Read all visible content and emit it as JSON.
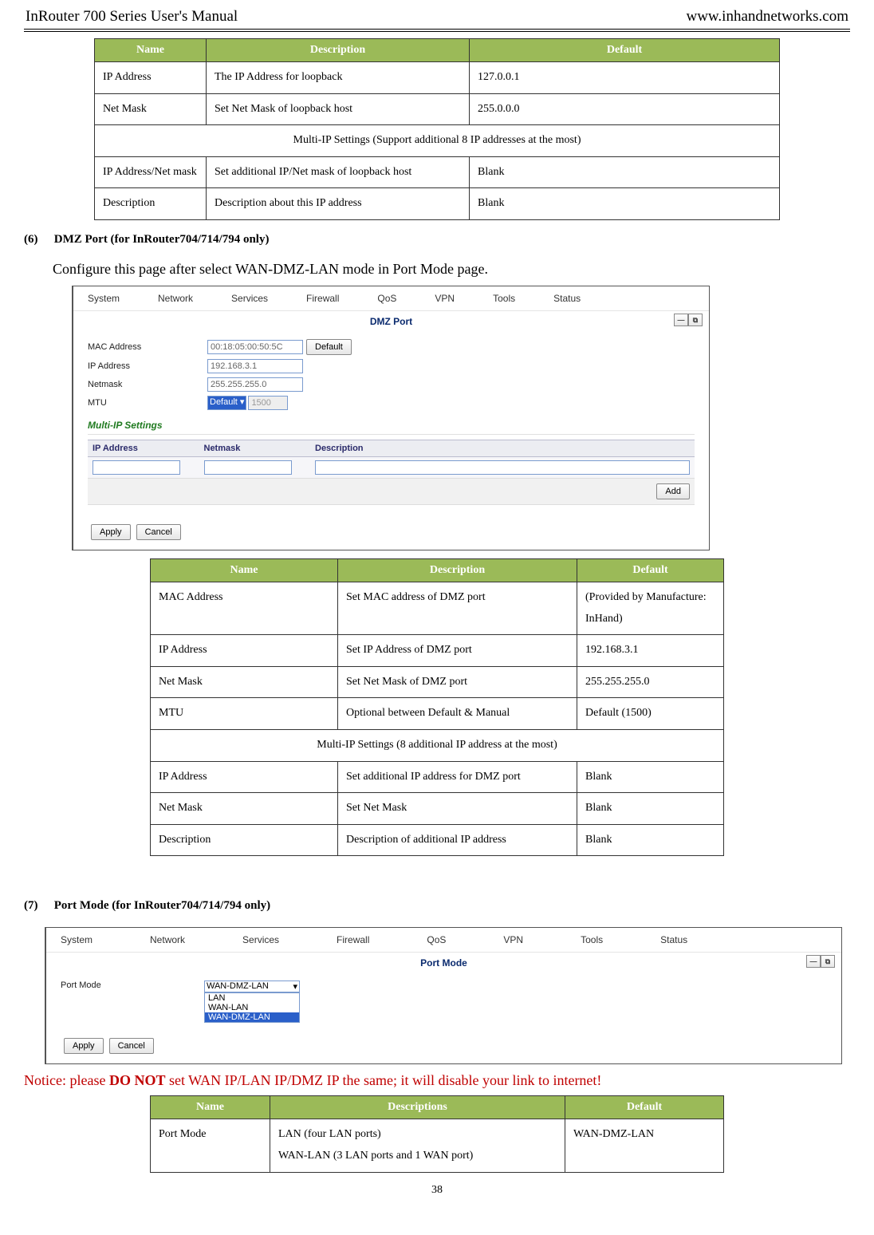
{
  "header": {
    "left": "InRouter 700 Series User's Manual",
    "right": "www.inhandnetworks.com"
  },
  "table1": {
    "headers": [
      "Name",
      "Description",
      "Default"
    ],
    "rows": [
      [
        "IP Address",
        "The IP Address for loopback",
        "127.0.0.1"
      ],
      [
        "Net Mask",
        "Set Net Mask of loopback host",
        "255.0.0.0"
      ]
    ],
    "section_row": "Multi-IP Settings (Support additional 8 IP addresses at the most)",
    "rows2": [
      [
        "IP Address/Net mask",
        "Set additional IP/Net mask of loopback host",
        "Blank"
      ],
      [
        "Description",
        "Description about this IP address",
        "Blank"
      ]
    ]
  },
  "section6": {
    "num": "(6)",
    "title": "DMZ Port (for InRouter704/714/794 only)",
    "intro": "Configure this page after select WAN-DMZ-LAN mode in Port Mode page."
  },
  "screenshot1": {
    "menu": [
      "System",
      "Network",
      "Services",
      "Firewall",
      "QoS",
      "VPN",
      "Tools",
      "Status"
    ],
    "title": "DMZ Port",
    "fields": {
      "mac_label": "MAC Address",
      "mac_value": "00:18:05:00:50:5C",
      "default_btn": "Default",
      "ip_label": "IP Address",
      "ip_value": "192.168.3.1",
      "netmask_label": "Netmask",
      "netmask_value": "255.255.255.0",
      "mtu_label": "MTU",
      "mtu_select": "Default",
      "mtu_value": "1500"
    },
    "multiip_title": "Multi-IP Settings",
    "iptable_headers": [
      "IP Address",
      "Netmask",
      "Description"
    ],
    "add_btn": "Add",
    "apply_btn": "Apply",
    "cancel_btn": "Cancel"
  },
  "table2": {
    "headers": [
      "Name",
      "Description",
      "Default"
    ],
    "rows": [
      [
        "MAC Address",
        "Set MAC address of DMZ port",
        "(Provided by Manufacture: InHand)"
      ],
      [
        "IP Address",
        "Set IP Address of DMZ port",
        "192.168.3.1"
      ],
      [
        "Net Mask",
        "Set Net Mask of DMZ port",
        "255.255.255.0"
      ],
      [
        "MTU",
        "Optional between Default & Manual",
        "Default (1500)"
      ]
    ],
    "section_row": "Multi-IP Settings (8 additional IP address at the most)",
    "rows2": [
      [
        "IP Address",
        "Set additional IP address for DMZ port",
        "Blank"
      ],
      [
        "Net Mask",
        "Set Net Mask",
        "Blank"
      ],
      [
        "Description",
        "Description of additional IP address",
        "Blank"
      ]
    ]
  },
  "section7": {
    "num": "(7)",
    "title": "Port Mode (for InRouter704/714/794 only)"
  },
  "screenshot2": {
    "menu": [
      "System",
      "Network",
      "Services",
      "Firewall",
      "QoS",
      "VPN",
      "Tools",
      "Status"
    ],
    "title": "Port Mode",
    "pm_label": "Port Mode",
    "pm_select": "WAN-DMZ-LAN",
    "pm_options": [
      "LAN",
      "WAN-LAN",
      "WAN-DMZ-LAN"
    ],
    "apply_btn": "Apply",
    "cancel_btn": "Cancel"
  },
  "notice": {
    "prefix": "Notice: please ",
    "bold": "DO NOT",
    "suffix": " set WAN IP/LAN IP/DMZ IP the same; it will disable your link to internet!"
  },
  "table3": {
    "headers": [
      "Name",
      "Descriptions",
      "Default"
    ],
    "rows": [
      {
        "name": "Port Mode",
        "desc_lines": [
          "LAN (four LAN ports)",
          "WAN-LAN (3 LAN ports and 1 WAN port)"
        ],
        "default": "WAN-DMZ-LAN"
      }
    ]
  },
  "page_number": "38"
}
